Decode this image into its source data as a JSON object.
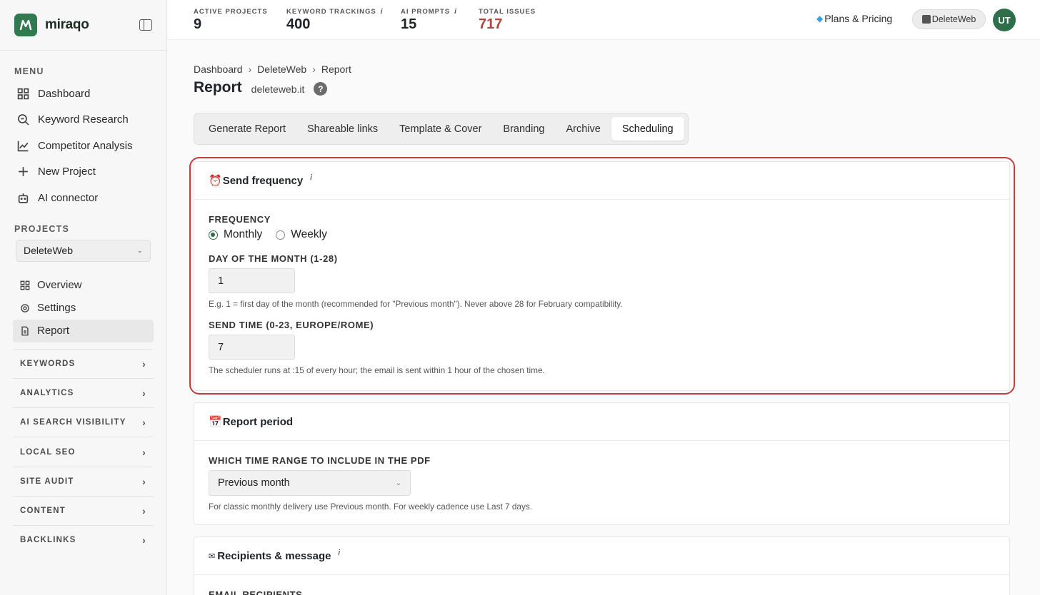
{
  "brand": {
    "name": "miraqo",
    "logo_letter": "M"
  },
  "sidebar": {
    "menu_label": "MENU",
    "items": [
      {
        "label": "Dashboard",
        "icon": "grid-icon"
      },
      {
        "label": "Keyword Research",
        "icon": "search-icon"
      },
      {
        "label": "Competitor Analysis",
        "icon": "chart-line-icon"
      },
      {
        "label": "New Project",
        "icon": "plus-icon"
      },
      {
        "label": "AI connector",
        "icon": "robot-icon"
      }
    ],
    "projects_label": "PROJECTS",
    "project_selected": "DeleteWeb",
    "project_items": [
      {
        "label": "Overview",
        "icon": "grid-icon"
      },
      {
        "label": "Settings",
        "icon": "gear-icon"
      },
      {
        "label": "Report",
        "icon": "document-icon",
        "active": true
      }
    ],
    "groups": [
      "KEYWORDS",
      "ANALYTICS",
      "AI SEARCH VISIBILITY",
      "LOCAL SEO",
      "SITE AUDIT",
      "CONTENT",
      "BACKLINKS"
    ]
  },
  "topbar": {
    "stats": [
      {
        "label": "ACTIVE PROJECTS",
        "value": "9",
        "info": false
      },
      {
        "label": "KEYWORD TRACKINGS",
        "value": "400",
        "info": true
      },
      {
        "label": "AI PROMPTS",
        "value": "15",
        "info": true
      },
      {
        "label": "TOTAL ISSUES",
        "value": "717",
        "info": false,
        "danger": true
      }
    ],
    "plans_label": "Plans & Pricing",
    "workspace": "DeleteWeb",
    "avatar_initials": "UT",
    "info_glyph": "i"
  },
  "breadcrumb": [
    "Dashboard",
    "DeleteWeb",
    "Report"
  ],
  "breadcrumb_sep": "›",
  "page": {
    "title": "Report",
    "domain": "deleteweb.it",
    "help": "?"
  },
  "tabs": [
    "Generate Report",
    "Shareable links",
    "Template & Cover",
    "Branding",
    "Archive",
    "Scheduling"
  ],
  "active_tab": "Scheduling",
  "send_frequency": {
    "title": "Send frequency",
    "emoji": "⏰",
    "frequency_label": "FREQUENCY",
    "options": [
      "Monthly",
      "Weekly"
    ],
    "selected": "Monthly",
    "day_label": "DAY OF THE MONTH (1-28)",
    "day_value": "1",
    "day_hint": "E.g. 1 = first day of the month (recommended for \"Previous month\"). Never above 28 for February compatibility.",
    "time_label": "SEND TIME (0-23, EUROPE/ROME)",
    "time_value": "7",
    "time_hint": "The scheduler runs at :15 of every hour; the email is sent within 1 hour of the chosen time."
  },
  "report_period": {
    "title": "Report period",
    "emoji": "📅",
    "range_label": "WHICH TIME RANGE TO INCLUDE IN THE PDF",
    "range_value": "Previous month",
    "range_hint": "For classic monthly delivery use Previous month. For weekly cadence use Last 7 days."
  },
  "recipients": {
    "title": "Recipients & message",
    "emoji": "✉",
    "email_label": "EMAIL RECIPIENTS"
  },
  "colors": {
    "accent": "#2f7a4f",
    "danger": "#b5413b",
    "highlight": "#c23d3d"
  }
}
